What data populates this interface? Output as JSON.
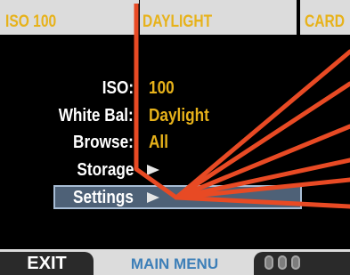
{
  "status": {
    "iso": "ISO 100",
    "white_balance": "DAYLIGHT",
    "storage": "CARD"
  },
  "menu": {
    "rows": [
      {
        "label": "ISO:",
        "value": "100"
      },
      {
        "label": "White Bal:",
        "value": "Daylight"
      },
      {
        "label": "Browse:",
        "value": "All"
      },
      {
        "label": "Storage",
        "value": ""
      },
      {
        "label": "Settings",
        "value": ""
      }
    ],
    "selected_index": 4
  },
  "footer": {
    "exit": "EXIT",
    "title": "MAIN MENU"
  },
  "colors": {
    "accent": "#e7b21a",
    "selection": "#4e6177",
    "footer_title": "#3d7fb8",
    "cable": "#e84a24"
  },
  "icons": [
    "storage-arrow-icon",
    "settings-arrow-icon",
    "page-dots-icon"
  ]
}
